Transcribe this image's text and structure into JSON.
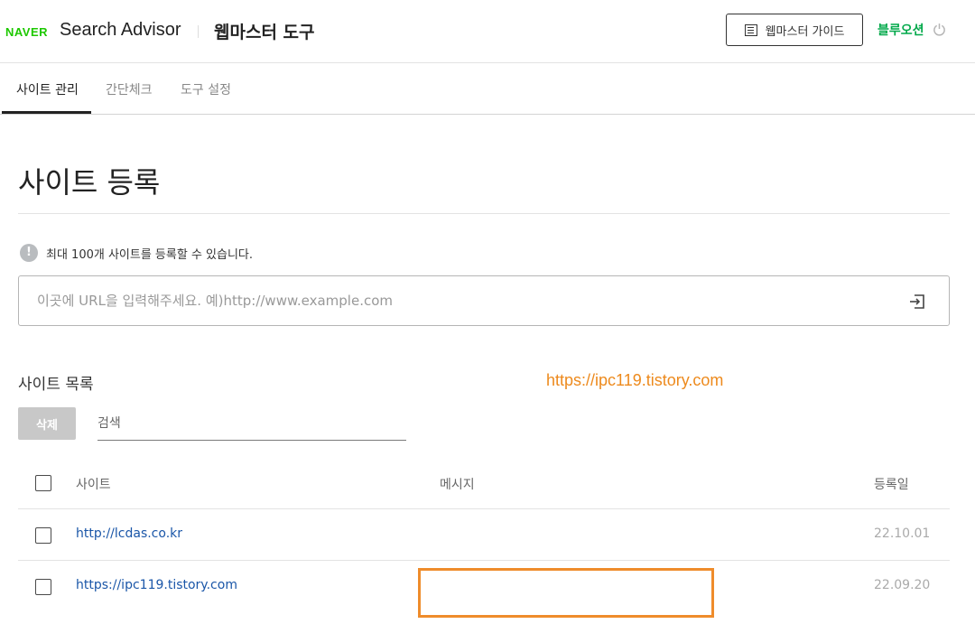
{
  "header": {
    "brand": "NAVER",
    "app_name": "Search Advisor",
    "tool_title": "웹마스터 도구",
    "guide_button": "웹마스터 가이드",
    "user_name": "블루오션",
    "brand_color": "#1ec800",
    "user_color": "#03a94b"
  },
  "tabs": [
    {
      "label": "사이트 관리",
      "active": true
    },
    {
      "label": "간단체크",
      "active": false
    },
    {
      "label": "도구 설정",
      "active": false
    }
  ],
  "main": {
    "title": "사이트 등록",
    "notice": "최대 100개 사이트를 등록할 수 있습니다.",
    "url_placeholder": "이곳에 URL을 입력해주세요. 예)http://www.example.com"
  },
  "site_list": {
    "title": "사이트 목록",
    "watermark": "https://ipc119.tistory.com",
    "delete_button": "삭제",
    "search_placeholder": "검색",
    "columns": {
      "site": "사이트",
      "message": "메시지",
      "date": "등록일"
    },
    "rows": [
      {
        "site": "http://lcdas.co.kr",
        "message": "",
        "date": "22.10.01"
      },
      {
        "site": "https://ipc119.tistory.com",
        "message": "",
        "date": "22.09.20"
      }
    ]
  },
  "icons": {
    "guide": "list-doc-icon",
    "logout": "power-icon",
    "notice": "exclamation-icon",
    "submit": "enter-arrow-icon"
  },
  "colors": {
    "watermark": "#ed8a1d",
    "highlight": "#ef8c2b",
    "link": "#1a56a8"
  }
}
